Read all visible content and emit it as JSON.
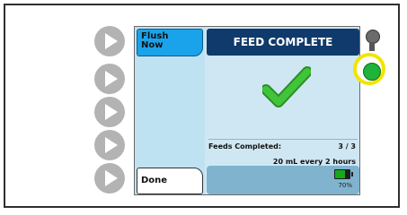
{
  "screen": {
    "softkeys": {
      "top": "Flush\nNow",
      "bottom": "Done"
    },
    "header": "FEED COMPLETE",
    "feeds_completed_label": "Feeds Completed:",
    "feeds_completed_value": "3 / 3",
    "rate": "20 mL every 2 hours",
    "battery": {
      "level": 0.7,
      "text": "70%"
    }
  },
  "icons": {
    "check": "check-icon",
    "battery": "battery-icon",
    "left_buttons": [
      "play-arrow-icon",
      "play-arrow-icon",
      "play-arrow-icon",
      "play-arrow-icon",
      "play-arrow-icon"
    ],
    "leds": [
      "status-led-gray",
      "status-led-green"
    ]
  },
  "colors": {
    "header_bg": "#0f3a6b",
    "flush_bg": "#1aa3ea",
    "check": "#33b52f",
    "led_ring": "#f3e400",
    "led_green": "#1fb33a"
  }
}
